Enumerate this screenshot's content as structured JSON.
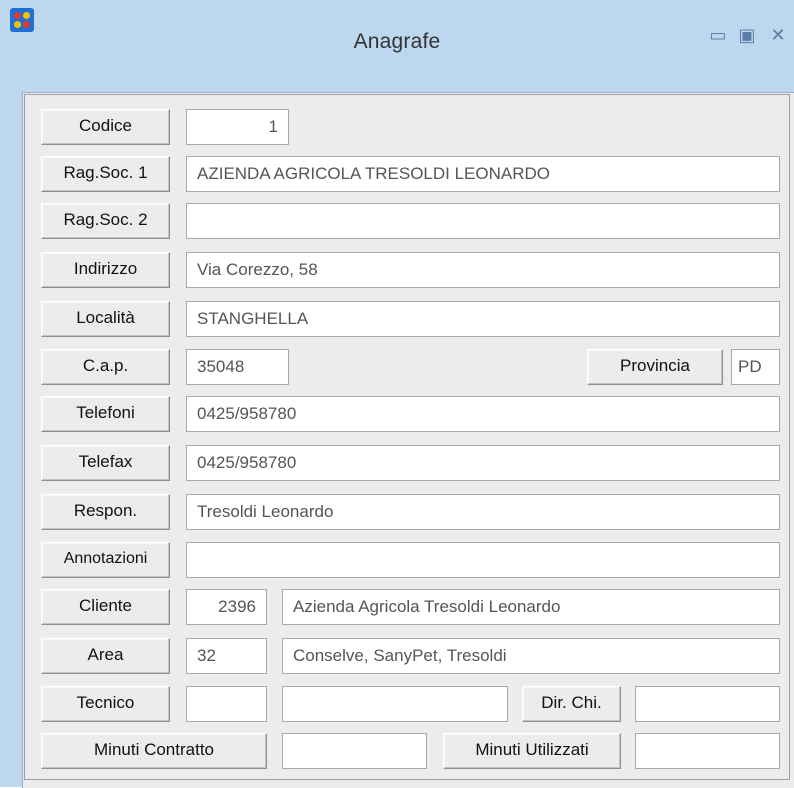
{
  "window": {
    "title": "Anagrafe",
    "minimize_glyph": "▭",
    "maximize_glyph": "▣",
    "close_glyph": "✕"
  },
  "form": {
    "codice": {
      "label": "Codice",
      "value": "1"
    },
    "ragsoc1": {
      "label": "Rag.Soc. 1",
      "value": "AZIENDA AGRICOLA TRESOLDI LEONARDO"
    },
    "ragsoc2": {
      "label": "Rag.Soc. 2",
      "value": ""
    },
    "indirizzo": {
      "label": "Indirizzo",
      "value": "Via Corezzo, 58"
    },
    "localita": {
      "label": "Località",
      "value": "STANGHELLA"
    },
    "cap": {
      "label": "C.a.p.",
      "value": "35048"
    },
    "provincia": {
      "label": "Provincia",
      "value": "PD"
    },
    "telefoni": {
      "label": "Telefoni",
      "value": "0425/958780"
    },
    "telefax": {
      "label": "Telefax",
      "value": "0425/958780"
    },
    "respon": {
      "label": "Respon.",
      "value": "Tresoldi Leonardo"
    },
    "annotazioni": {
      "label": "Annotazioni",
      "value": ""
    },
    "cliente": {
      "label": "Cliente",
      "code": "2396",
      "name": "Azienda Agricola Tresoldi Leonardo"
    },
    "area": {
      "label": "Area",
      "code": "32",
      "name": "Conselve, SanyPet, Tresoldi"
    },
    "tecnico": {
      "label": "Tecnico",
      "code": "",
      "name": ""
    },
    "dirchi": {
      "label": "Dir. Chi.",
      "value": ""
    },
    "minuti_contratto": {
      "label": "Minuti Contratto",
      "value": ""
    },
    "minuti_utilizzati": {
      "label": "Minuti Utilizzati",
      "value": ""
    }
  },
  "icons": {
    "app": "app-logo-icon",
    "minimize": "minimize-icon",
    "maximize": "maximize-icon",
    "close": "close-icon"
  },
  "colors": {
    "titlebar": "#bcd7ee",
    "client": "#ececec",
    "field": "#ffffff"
  }
}
